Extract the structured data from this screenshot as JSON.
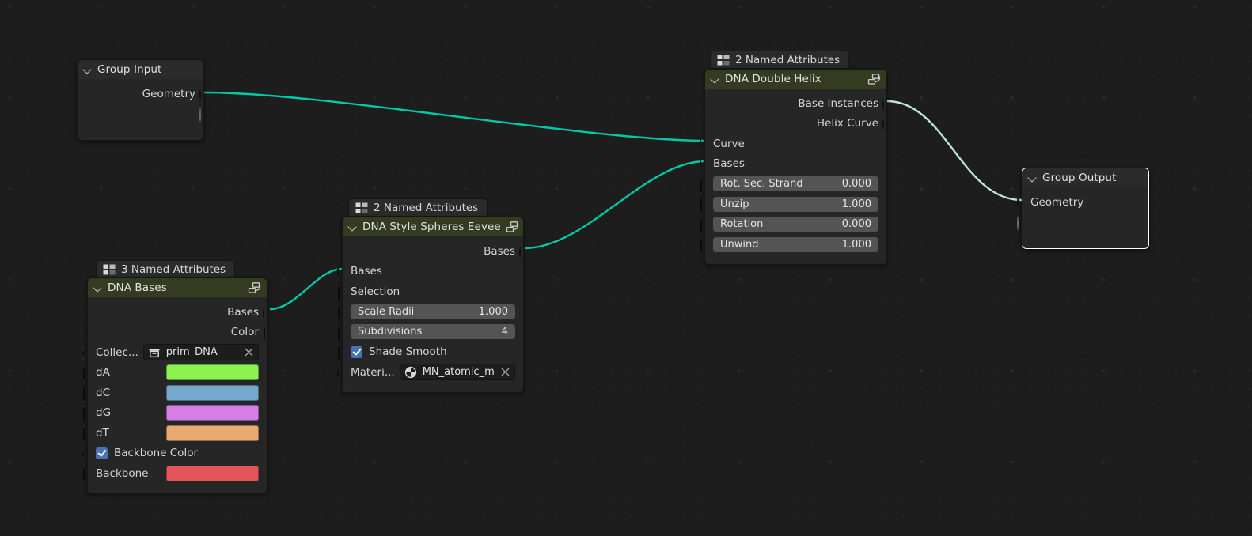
{
  "app": {
    "editor": "blender-geometry-node-editor",
    "background": "#1d1d1d"
  },
  "palette": {
    "geometry_socket": "#00c7a7",
    "boolean_socket": "#cc70d9",
    "float_socket": "#a1a1a1",
    "integer_socket": "#598c5c",
    "material_socket": "#ec6e6e",
    "color_socket": "#ffff2f",
    "collection_socket": "#f5f5f5",
    "link_green": "#00c9a7",
    "link_highlight": "#bfe6dc",
    "header_group": "#333c20",
    "header_plain": "#2b2b2b",
    "node_body": "#262626"
  },
  "nodes": {
    "group_input": {
      "title": "Group Input",
      "outputs": [
        {
          "label": "Geometry",
          "socket": "geometry"
        },
        {
          "label": "",
          "socket": "virtual"
        }
      ]
    },
    "dna_bases": {
      "badge": "3 Named Attributes",
      "title": "DNA Bases",
      "outputs": [
        {
          "label": "Bases",
          "socket": "geometry"
        },
        {
          "label": "Color",
          "socket": "color"
        }
      ],
      "inputs": [
        {
          "label": "Collec...",
          "socket": "collection",
          "type": "id",
          "icon": "collection-icon",
          "value": "prim_DNA"
        },
        {
          "label": "dA",
          "socket": "color",
          "type": "swatch",
          "value": "#8cf24f"
        },
        {
          "label": "dC",
          "socket": "color",
          "type": "swatch",
          "value": "#74a9cb"
        },
        {
          "label": "dG",
          "socket": "color",
          "type": "swatch",
          "value": "#d57fe6"
        },
        {
          "label": "dT",
          "socket": "color",
          "type": "swatch",
          "value": "#e9aa71"
        },
        {
          "label": "Backbone Color",
          "socket": "boolean",
          "type": "checkbox",
          "checked": true
        },
        {
          "label": "Backbone",
          "socket": "color",
          "type": "swatch",
          "value": "#e3555b"
        }
      ]
    },
    "dna_style_spheres": {
      "badge": "2 Named Attributes",
      "title": "DNA Style Spheres Eevee",
      "outputs": [
        {
          "label": "Bases",
          "socket": "geometry"
        }
      ],
      "inputs": [
        {
          "label": "Bases",
          "socket": "geometry",
          "type": "plain"
        },
        {
          "label": "Selection",
          "socket": "boolean",
          "type": "plain"
        },
        {
          "label": "Scale Radii",
          "socket": "float",
          "type": "value",
          "value": "1.000"
        },
        {
          "label": "Subdivisions",
          "socket": "integer",
          "type": "value",
          "value": "4"
        },
        {
          "label": "Shade Smooth",
          "socket": "boolean",
          "type": "checkbox",
          "checked": true
        },
        {
          "label": "Materi...",
          "socket": "material",
          "type": "id",
          "icon": "material-icon",
          "value": "MN_atomic_m..."
        }
      ]
    },
    "dna_double_helix": {
      "badge": "2 Named Attributes",
      "title": "DNA Double Helix",
      "outputs": [
        {
          "label": "Base Instances",
          "socket": "geometry"
        },
        {
          "label": "Helix Curve",
          "socket": "geometry"
        }
      ],
      "inputs": [
        {
          "label": "Curve",
          "socket": "geometry",
          "type": "plain"
        },
        {
          "label": "Bases",
          "socket": "geometry",
          "type": "plain"
        },
        {
          "label": "Rot. Sec. Strand",
          "socket": "float",
          "type": "value",
          "value": "0.000"
        },
        {
          "label": "Unzip",
          "socket": "float",
          "type": "value",
          "value": "1.000"
        },
        {
          "label": "Rotation",
          "socket": "float",
          "type": "value",
          "value": "0.000"
        },
        {
          "label": "Unwind",
          "socket": "float",
          "type": "value",
          "value": "1.000"
        }
      ]
    },
    "group_output": {
      "title": "Group Output",
      "selected": true,
      "inputs": [
        {
          "label": "Geometry",
          "socket": "geometry"
        },
        {
          "label": "",
          "socket": "virtual"
        }
      ]
    }
  },
  "links": [
    {
      "from": "group_input.Geometry",
      "to": "dna_double_helix.Curve",
      "color": "#00c9a7"
    },
    {
      "from": "dna_bases.Bases",
      "to": "dna_style_spheres.Bases",
      "color": "#00c9a7"
    },
    {
      "from": "dna_style_spheres.Bases",
      "to": "dna_double_helix.Bases",
      "color": "#00c9a7"
    },
    {
      "from": "dna_double_helix.Base Instances",
      "to": "group_output.Geometry",
      "color": "#bfe6dc"
    }
  ]
}
